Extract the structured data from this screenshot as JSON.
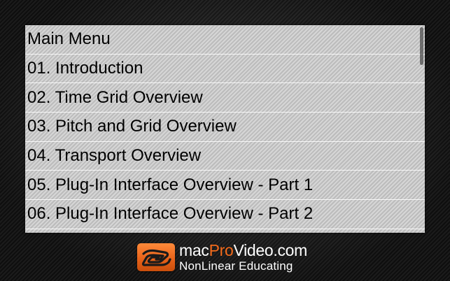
{
  "menu": {
    "title": "Main Menu",
    "items": [
      {
        "label": "01. Introduction"
      },
      {
        "label": "02. Time Grid Overview"
      },
      {
        "label": "03. Pitch and Grid Overview"
      },
      {
        "label": "04. Transport Overview"
      },
      {
        "label": "05. Plug-In Interface Overview - Part 1"
      },
      {
        "label": "06. Plug-In Interface Overview - Part 2"
      }
    ]
  },
  "footer": {
    "brand_prefix": "mac",
    "brand_accent": "Pro",
    "brand_suffix": "Video.com",
    "tagline": "NonLinear Educating"
  },
  "colors": {
    "accent": "#f26a1b",
    "row_text": "#000000"
  },
  "icons": {
    "logo": "macprovideo-logo-icon"
  }
}
